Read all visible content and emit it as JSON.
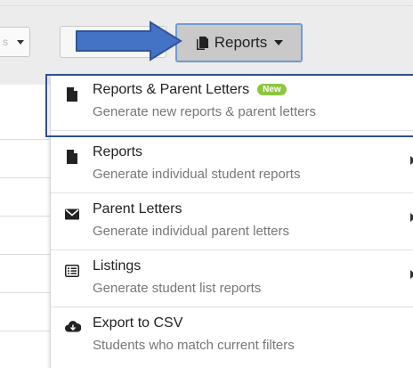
{
  "toolbar": {
    "reports_button_label": "Reports",
    "left_dropdown_ghost": "s"
  },
  "menu": {
    "items": [
      {
        "title": "Reports & Parent Letters",
        "badge": "New",
        "description": "Generate new reports & parent letters",
        "icon": "file-icon",
        "has_submenu": false
      },
      {
        "title": "Reports",
        "description": "Generate individual student reports",
        "icon": "file-icon",
        "has_submenu": true
      },
      {
        "title": "Parent Letters",
        "description": "Generate individual parent letters",
        "icon": "envelope-icon",
        "has_submenu": true
      },
      {
        "title": "Listings",
        "description": "Generate student list reports",
        "icon": "list-icon",
        "has_submenu": true
      },
      {
        "title": "Export to CSV",
        "description": "Students who match current filters",
        "icon": "cloud-download-icon",
        "has_submenu": false
      }
    ]
  },
  "colors": {
    "arrow": "#4472c4",
    "highlight_border": "#2f4f8f",
    "badge": "#8dc63f",
    "reports_button_bg": "#c9c9c9"
  }
}
